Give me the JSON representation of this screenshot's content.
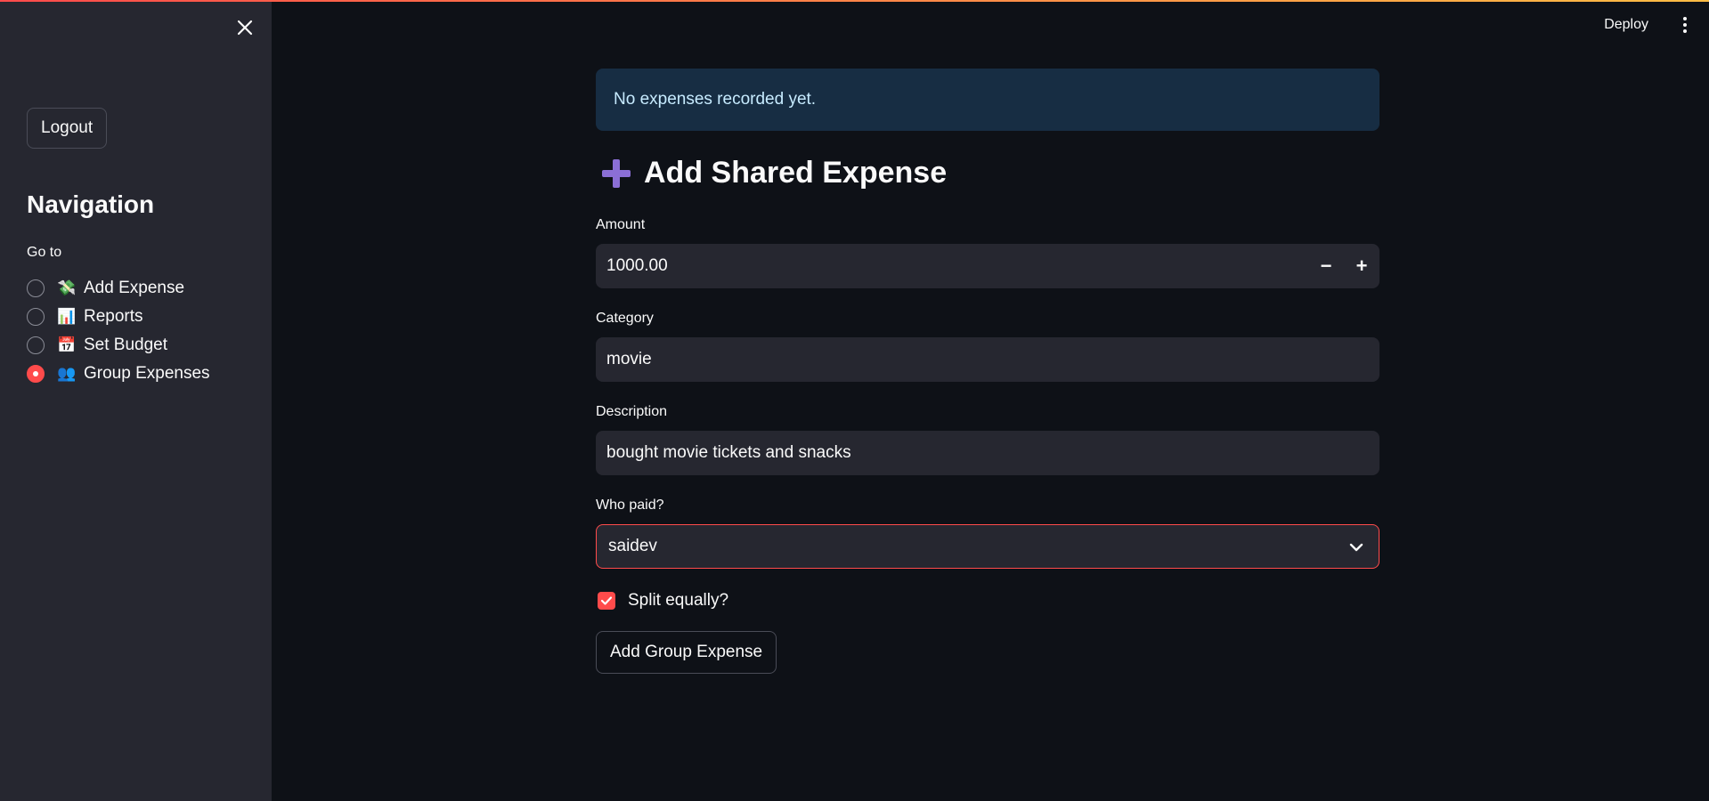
{
  "sidebar": {
    "close_icon": "close-icon",
    "logout_label": "Logout",
    "nav_title": "Navigation",
    "goto_label": "Go to",
    "items": [
      {
        "emoji": "💸",
        "label": "Add Expense",
        "selected": false
      },
      {
        "emoji": "📊",
        "label": "Reports",
        "selected": false
      },
      {
        "emoji": "📅",
        "label": "Set Budget",
        "selected": false
      },
      {
        "emoji": "👥",
        "label": "Group Expenses",
        "selected": true
      }
    ]
  },
  "header": {
    "deploy_label": "Deploy",
    "menu_icon": "kebab-menu-icon"
  },
  "main": {
    "info_message": "No expenses recorded yet.",
    "section_title": "Add Shared Expense",
    "section_icon": "plus-icon",
    "amount": {
      "label": "Amount",
      "value": "1000.00",
      "minus": "−",
      "plus": "+"
    },
    "category": {
      "label": "Category",
      "value": "movie"
    },
    "description": {
      "label": "Description",
      "value": "bought movie tickets and snacks"
    },
    "who_paid": {
      "label": "Who paid?",
      "value": "saidev"
    },
    "split_equally": {
      "label": "Split equally?",
      "checked": true
    },
    "submit_label": "Add Group Expense"
  },
  "colors": {
    "accent": "#ff4b4b",
    "sidebar_bg": "#262730",
    "main_bg": "#0e1117",
    "info_bg": "#172d43",
    "plus_icon": "#8b6fd6"
  }
}
